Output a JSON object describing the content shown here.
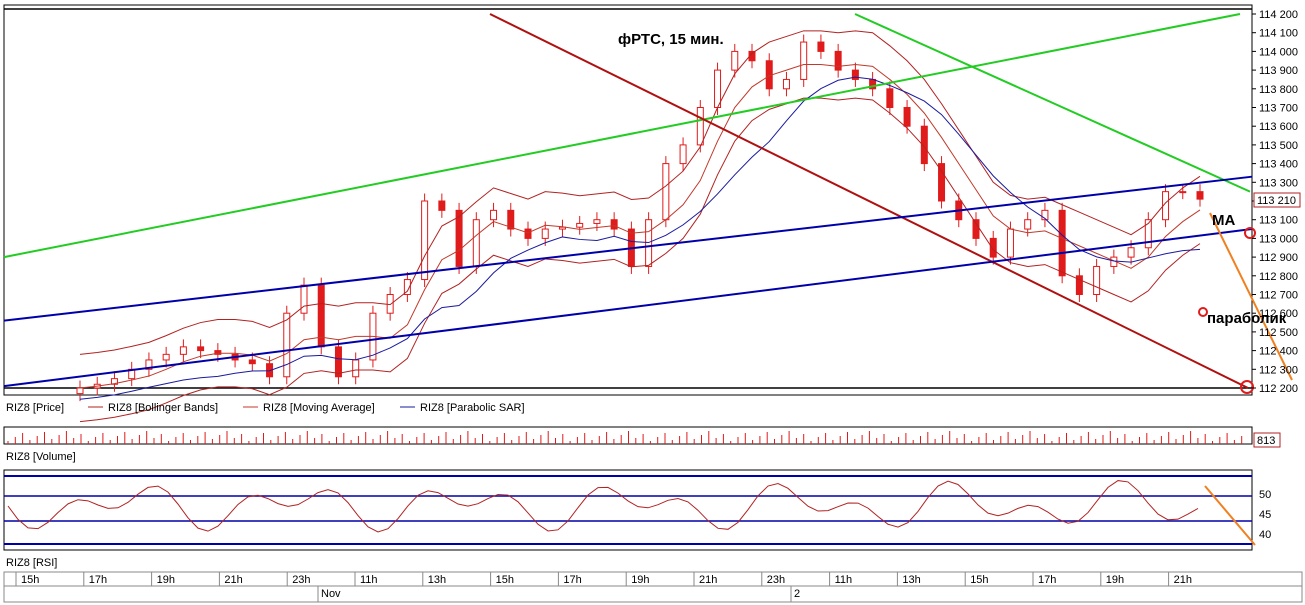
{
  "chart_data": [
    {
      "type": "candlestick",
      "title": "фРТС, 15 мин.",
      "ylim": [
        112200,
        114200
      ],
      "yticks": [
        114200,
        114100,
        114000,
        113900,
        113800,
        113700,
        113600,
        113500,
        113400,
        113300,
        113200,
        113100,
        113000,
        112900,
        112800,
        112700,
        112600,
        112500,
        112400,
        112300,
        112200
      ],
      "last_price": "113 210",
      "legend": [
        "RIZ8 [Price]",
        "RIZ8 [Bollinger Bands]",
        "RIZ8 [Moving Average]",
        "RIZ8 [Parabolic SAR]"
      ],
      "annotations": [
        "MA",
        "параболик"
      ],
      "candles_close_approx": [
        112200,
        112220,
        112250,
        112300,
        112350,
        112380,
        112420,
        112400,
        112380,
        112350,
        112330,
        112260,
        112600,
        112750,
        112420,
        112260,
        112350,
        112600,
        112700,
        112780,
        113200,
        113150,
        112850,
        113100,
        113150,
        113050,
        113000,
        113050,
        113060,
        113080,
        113100,
        113050,
        112850,
        113100,
        113400,
        113500,
        113700,
        113900,
        114000,
        113950,
        113800,
        113850,
        114050,
        114000,
        113900,
        113850,
        113800,
        113700,
        113600,
        113400,
        113200,
        113100,
        113000,
        112900,
        113050,
        113100,
        113150,
        112800,
        112700,
        112850,
        112900,
        112950,
        113100,
        113250,
        113250,
        113210
      ],
      "trendlines": {
        "green_upper": [
          [
            112900,
            113950
          ],
          [
            114200,
            114200
          ]
        ],
        "green_down": [
          [
            114200,
            113250
          ]
        ],
        "red_down": [
          [
            114200,
            112200
          ]
        ],
        "blue_channel": [
          [
            112560,
            113330
          ],
          [
            112210,
            113050
          ]
        ]
      }
    },
    {
      "type": "bar",
      "title": "RIZ8 [Volume]",
      "last_value": "813"
    },
    {
      "type": "line",
      "title": "RIZ8 [RSI]",
      "yticks": [
        50,
        45,
        40
      ],
      "levels": [
        50,
        45
      ]
    }
  ],
  "time_axis": {
    "labels": [
      "15h",
      "17h",
      "19h",
      "21h",
      "23h",
      "11h",
      "13h",
      "15h",
      "17h",
      "19h",
      "21h",
      "23h",
      "11h",
      "13h",
      "15h",
      "17h",
      "19h",
      "21h"
    ],
    "day_labels": [
      "Nov",
      "2"
    ]
  },
  "colors": {
    "candle": "#e01b1b",
    "bollinger": "#b22222",
    "moving_average": "#c0392b",
    "parabolic_sar": "#1a1aa0",
    "channel": "#0000aa",
    "green_trend": "#22cc22",
    "red_trend": "#b01010",
    "forecast_arrow": "#f08020"
  }
}
